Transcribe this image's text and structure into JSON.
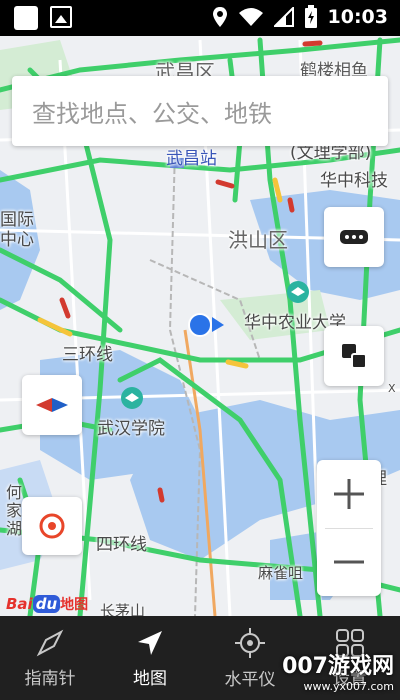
{
  "status_bar": {
    "time": "10:03"
  },
  "search": {
    "placeholder": "查找地点、公交、地铁"
  },
  "map_labels": {
    "wuchang_district": "武昌区",
    "wuchang_station": "武昌站",
    "huazhong_keji": "华中科技",
    "hongshan_district": "洪山区",
    "huazhong_agri_univ": "华中农业大学",
    "ring_road_3": "三环线",
    "wuhan_college": "武汉学院",
    "ring_road_4": "四环线",
    "maqiao": "麻雀咀",
    "guoji_zhongxin": "国际\n中心",
    "huanghe_liyuan": "鹤楼相鱼",
    "he_li": "何\n家\n湖",
    "dongli": "(文理学部)",
    "li": "理",
    "changmingshan": "长茅山",
    "x_mark": "X"
  },
  "logo": {
    "bai": "Bai",
    "du": "du",
    "ditu": "地图"
  },
  "tabs": [
    {
      "label": "指南针",
      "icon": "compass-icon"
    },
    {
      "label": "地图",
      "icon": "navigation-arrow-icon"
    },
    {
      "label": "水平仪",
      "icon": "level-crosshair-icon"
    },
    {
      "label": "设置",
      "icon": "grid-icon"
    }
  ],
  "watermark": {
    "brand": "007游戏网",
    "url": "www.yx007.com"
  },
  "colors": {
    "traffic_green": "#3fcf6a",
    "traffic_yellow": "#f5c43a",
    "traffic_red": "#d23a2f",
    "water": "#a8c9f0",
    "location_blue": "#2a73e8"
  }
}
